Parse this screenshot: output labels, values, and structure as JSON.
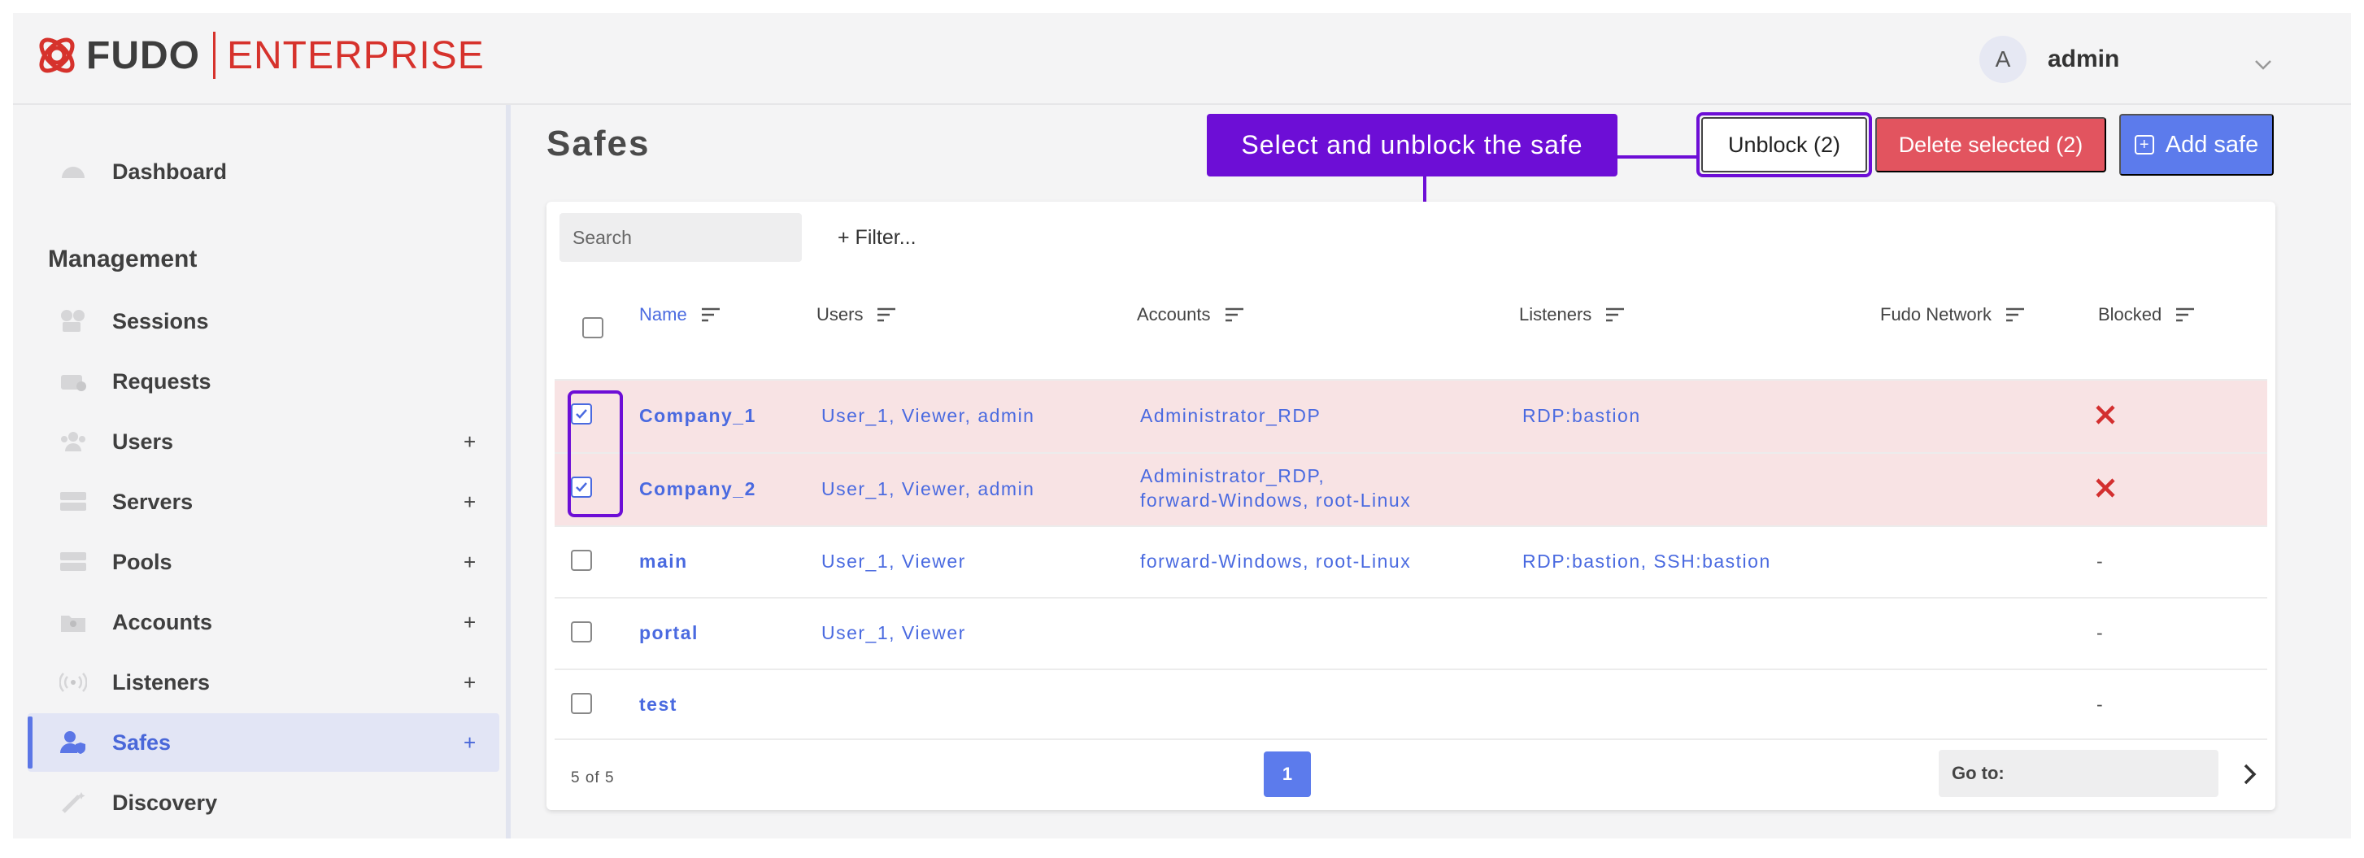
{
  "brand": {
    "name": "FUDO",
    "product": "ENTERPRISE",
    "accent": "#d6322c"
  },
  "user": {
    "avatar_letter": "A",
    "name": "admin"
  },
  "sidebar": {
    "items": [
      {
        "label": "Dashboard",
        "icon": "dashboard-icon"
      },
      {
        "label": "Sessions",
        "icon": "sessions-icon",
        "plus": ""
      },
      {
        "label": "Requests",
        "icon": "requests-icon",
        "plus": ""
      },
      {
        "label": "Users",
        "icon": "users-icon",
        "plus": "+"
      },
      {
        "label": "Servers",
        "icon": "servers-icon",
        "plus": "+"
      },
      {
        "label": "Pools",
        "icon": "pools-icon",
        "plus": "+"
      },
      {
        "label": "Accounts",
        "icon": "accounts-icon",
        "plus": "+"
      },
      {
        "label": "Listeners",
        "icon": "listeners-icon",
        "plus": "+"
      },
      {
        "label": "Safes",
        "icon": "safes-icon",
        "plus": "+",
        "active": true
      },
      {
        "label": "Discovery",
        "icon": "discovery-icon"
      }
    ],
    "section_heading": "Management"
  },
  "page": {
    "title": "Safes"
  },
  "annotation": {
    "text": "Select and unblock the safe",
    "color": "#6d0ed6"
  },
  "toolbar": {
    "unblock_label": "Unblock (2)",
    "delete_label": "Delete selected (2)",
    "add_label": "Add safe"
  },
  "table": {
    "search_placeholder": "Search",
    "filter_label": "+ Filter...",
    "columns": [
      "Name",
      "Users",
      "Accounts",
      "Listeners",
      "Fudo Network",
      "Blocked"
    ],
    "rows": [
      {
        "name": "Company_1",
        "users": "User_1,  Viewer,  admin",
        "accounts": "Administrator_RDP",
        "accounts2": "",
        "listeners": "RDP:bastion",
        "fudo_network": "",
        "blocked": "x",
        "selected": true
      },
      {
        "name": "Company_2",
        "users": "User_1,  Viewer,  admin",
        "accounts": "Administrator_RDP,",
        "accounts2": "forward-Windows,  root-Linux",
        "listeners": "",
        "fudo_network": "",
        "blocked": "x",
        "selected": true
      },
      {
        "name": "main",
        "users": "User_1,  Viewer",
        "accounts": "forward-Windows,  root-Linux",
        "accounts2": "",
        "listeners": "RDP:bastion,  SSH:bastion",
        "fudo_network": "",
        "blocked": "-",
        "selected": false
      },
      {
        "name": "portal",
        "users": "User_1,  Viewer",
        "accounts": "",
        "accounts2": "",
        "listeners": "",
        "fudo_network": "",
        "blocked": "-",
        "selected": false
      },
      {
        "name": "test",
        "users": "",
        "accounts": "",
        "accounts2": "",
        "listeners": "",
        "fudo_network": "",
        "blocked": "-",
        "selected": false
      }
    ],
    "count_text": "5 of 5",
    "current_page": "1",
    "goto_label": "Go to:"
  },
  "colors": {
    "primary": "#5c7bec",
    "danger": "#e2545f",
    "selected_row": "#f8e3e4",
    "blocked_x": "#d32f2f"
  }
}
